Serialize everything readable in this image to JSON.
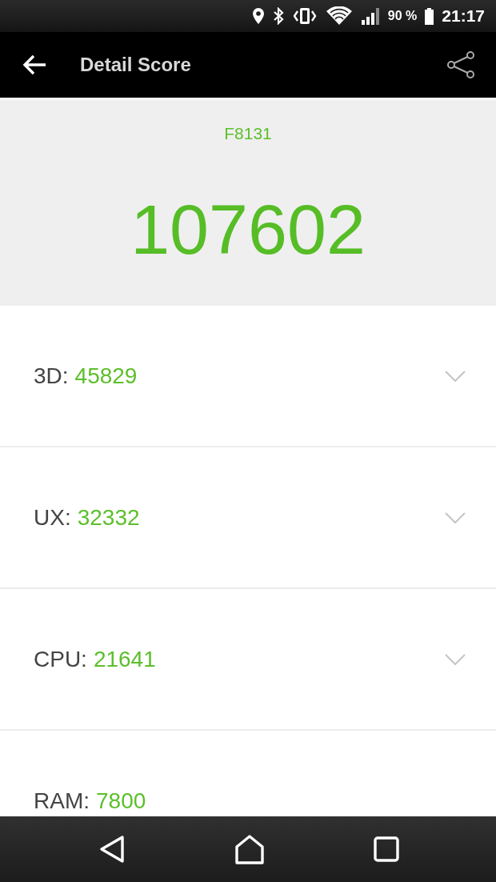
{
  "status_bar": {
    "battery": "90 %",
    "time": "21:17"
  },
  "app_bar": {
    "title": "Detail Score"
  },
  "summary": {
    "device": "F8131",
    "total_score": "107602"
  },
  "scores": [
    {
      "kind": "expandable",
      "label": "3D:",
      "value": "45829"
    },
    {
      "kind": "expandable",
      "label": "UX:",
      "value": "32332"
    },
    {
      "kind": "expandable",
      "label": "CPU:",
      "value": "21641"
    },
    {
      "kind": "plain",
      "label": "RAM:",
      "value": "7800"
    }
  ]
}
